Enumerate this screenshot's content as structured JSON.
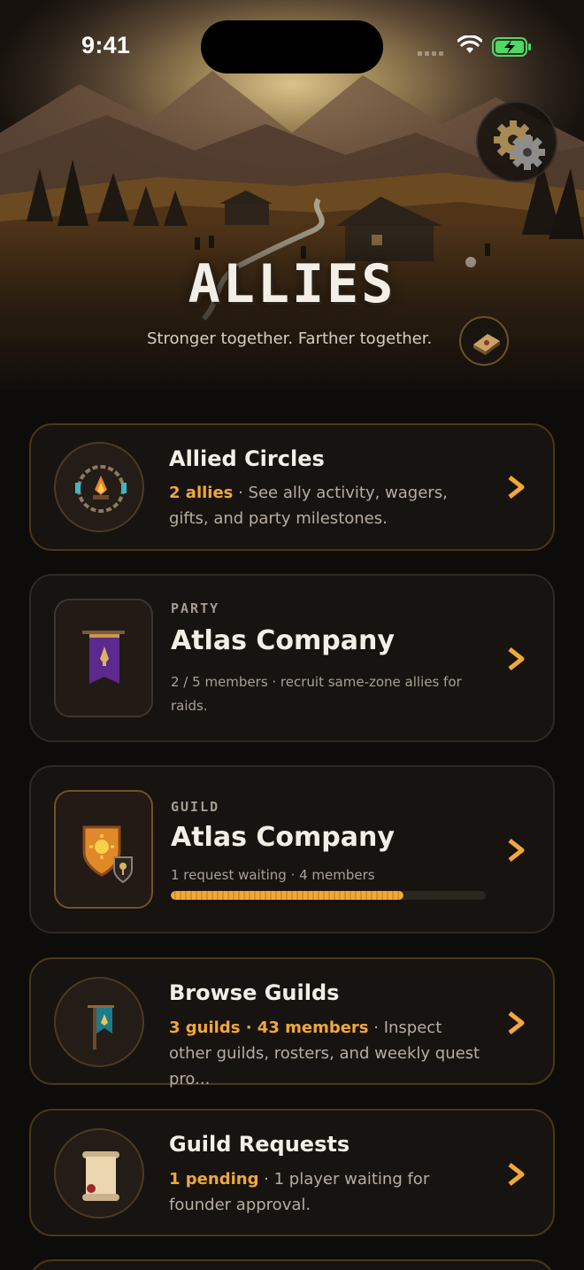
{
  "status_bar": {
    "time": "9:41"
  },
  "header": {
    "title": "ALLIES",
    "subtitle": "Stronger together. Farther together."
  },
  "colors": {
    "accent": "#f0a83a",
    "background": "#0e0c0a",
    "card": "#171310",
    "card_border_gold": "#4a3816"
  },
  "cards": [
    {
      "title": "Allied Circles",
      "highlight": "2 allies",
      "separator": " · ",
      "description": "See ally activity, wagers, gifts, and party milestones.",
      "icon": "campfire-icon"
    },
    {
      "kicker": "PARTY",
      "title": "Atlas Company",
      "description": "2 / 5 members · recruit same-zone allies for raids.",
      "icon": "purple-banner-icon"
    },
    {
      "kicker": "GUILD",
      "title": "Atlas Company",
      "description": "1 request waiting · 4 members",
      "progress": 0.74,
      "icon": "guild-shield-icon"
    },
    {
      "title": "Browse Guilds",
      "highlight": "3 guilds · 43 members",
      "separator": " · ",
      "description": "Inspect other guilds, rosters, and weekly quest pro...",
      "icon": "guild-banner-icon"
    },
    {
      "title": "Guild Requests",
      "highlight": "1 pending",
      "separator": " · ",
      "description": "1 player waiting for founder approval.",
      "icon": "scroll-icon"
    }
  ]
}
